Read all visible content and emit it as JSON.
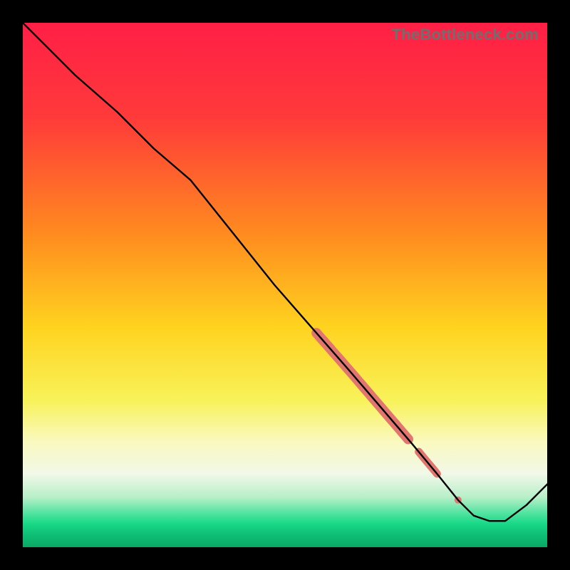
{
  "watermark": "TheBottleneck.com",
  "chart_data": {
    "type": "line",
    "title": "",
    "xlabel": "",
    "ylabel": "",
    "xlim": [
      0,
      100
    ],
    "ylim": [
      0,
      100
    ],
    "grid": false,
    "legend": false,
    "gradient_stops": [
      {
        "pos": 0.0,
        "color": "#ff1f46"
      },
      {
        "pos": 0.18,
        "color": "#ff3a3a"
      },
      {
        "pos": 0.4,
        "color": "#ff8a1f"
      },
      {
        "pos": 0.58,
        "color": "#ffd31f"
      },
      {
        "pos": 0.72,
        "color": "#f8f25a"
      },
      {
        "pos": 0.8,
        "color": "#faf9c0"
      },
      {
        "pos": 0.86,
        "color": "#f1f8e8"
      },
      {
        "pos": 0.905,
        "color": "#b7efc8"
      },
      {
        "pos": 0.935,
        "color": "#52e3a0"
      },
      {
        "pos": 0.955,
        "color": "#18d987"
      },
      {
        "pos": 0.975,
        "color": "#0fbf75"
      },
      {
        "pos": 1.0,
        "color": "#0aa864"
      }
    ],
    "series": [
      {
        "name": "bottleneck-curve",
        "color": "#000000",
        "x": [
          0,
          4,
          10,
          18,
          25,
          32,
          40,
          48,
          55,
          62,
          68,
          74,
          79,
          83,
          86,
          89,
          92,
          96,
          100
        ],
        "values": [
          100,
          96,
          90,
          83,
          76,
          70,
          60,
          50,
          42,
          34,
          27,
          20,
          14,
          9,
          6,
          5,
          5,
          8,
          12
        ]
      }
    ],
    "highlight_band": {
      "name": "highlight-segment",
      "color": "#e2766f",
      "x_start": 56,
      "x_end": 83,
      "gap": {
        "x_start": 73.5,
        "x_end": 75.5
      },
      "dots": [
        {
          "x": 73,
          "r": 4
        },
        {
          "x": 83,
          "r": 5
        }
      ]
    }
  }
}
